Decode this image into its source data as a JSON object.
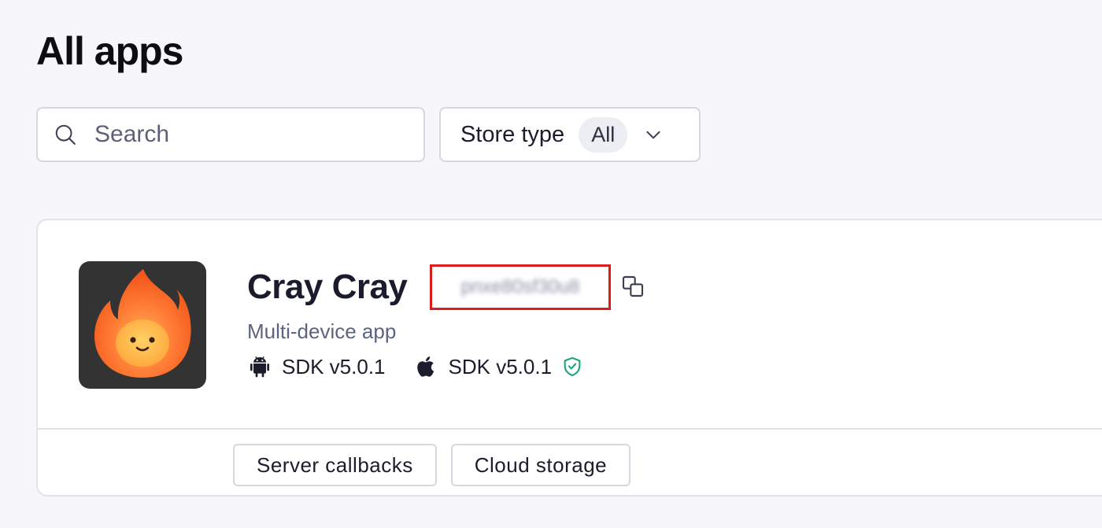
{
  "page": {
    "title": "All apps"
  },
  "search": {
    "placeholder": "Search",
    "value": ""
  },
  "filter": {
    "label": "Store type",
    "selected": "All"
  },
  "app": {
    "name": "Cray Cray",
    "id_redacted": "pnxe80sf30u8",
    "type": "Multi-device app",
    "sdks": [
      {
        "platform": "android-icon",
        "label": "SDK v5.0.1",
        "verified": false
      },
      {
        "platform": "apple-icon",
        "label": "SDK v5.0.1",
        "verified": true
      }
    ],
    "actions": [
      {
        "label": "Server callbacks"
      },
      {
        "label": "Cloud storage"
      }
    ]
  },
  "colors": {
    "background": "#f7f7f9",
    "highlight_box": "#d91c1c",
    "verified_shield": "#1fa37f",
    "app_icon_bg": "#333333",
    "flame": "#ff7a2f"
  }
}
